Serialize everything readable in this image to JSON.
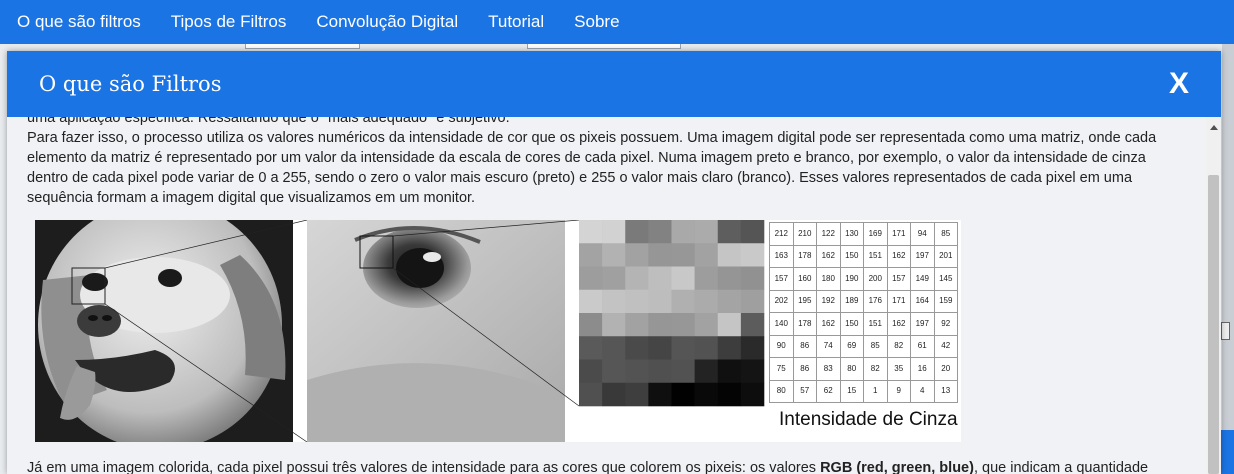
{
  "nav": {
    "items": [
      {
        "label": "O que são filtros"
      },
      {
        "label": "Tipos de Filtros"
      },
      {
        "label": "Convolução Digital"
      },
      {
        "label": "Tutorial"
      },
      {
        "label": "Sobre"
      }
    ]
  },
  "modal": {
    "title": "O que são Filtros",
    "close_label": "X",
    "clipped_text": "uma aplicação específica. Ressaltando que o \"mais adequado\" é subjetivo.",
    "paragraph": "Para fazer isso, o processo utiliza os valores numéricos da intensidade de cor que os pixeis possuem. Uma imagem digital pode ser representada como uma matriz, onde cada elemento da matriz é representado por um valor da intensidade da escala de cores de cada pixel. Numa imagem preto e branco, por exemplo, o valor da intensidade de cinza dentro de cada pixel pode variar de 0 a 255, sendo o zero o valor mais escuro (preto) e 255 o valor mais claro (branco). Esses valores representados de cada pixel em uma sequência formam a imagem digital que visualizamos em um monitor.",
    "after_before": "Já em uma imagem colorida, cada pixel possui três valores de intensidade para as cores que colorem os pixeis: os valores ",
    "after_bold": "RGB (red, green, blue)",
    "after_after": ", que indicam a quantidade"
  },
  "figure": {
    "caption": "Intensidade de Cinza",
    "matrix": [
      [
        "212",
        "210",
        "122",
        "130",
        "169",
        "171",
        "94",
        "85"
      ],
      [
        "163",
        "178",
        "162",
        "150",
        "151",
        "162",
        "197",
        "201"
      ],
      [
        "157",
        "160",
        "180",
        "190",
        "200",
        "157",
        "149",
        "145"
      ],
      [
        "202",
        "195",
        "192",
        "189",
        "176",
        "171",
        "164",
        "159"
      ],
      [
        "140",
        "178",
        "162",
        "150",
        "151",
        "162",
        "197",
        "92"
      ],
      [
        "90",
        "86",
        "74",
        "69",
        "85",
        "82",
        "61",
        "42"
      ],
      [
        "75",
        "86",
        "83",
        "80",
        "82",
        "35",
        "16",
        "20"
      ],
      [
        "80",
        "57",
        "62",
        "15",
        "1",
        "9",
        "4",
        "13"
      ]
    ]
  },
  "colors": {
    "primary": "#1b74e4",
    "modal_bg": "#f0f2f6"
  }
}
